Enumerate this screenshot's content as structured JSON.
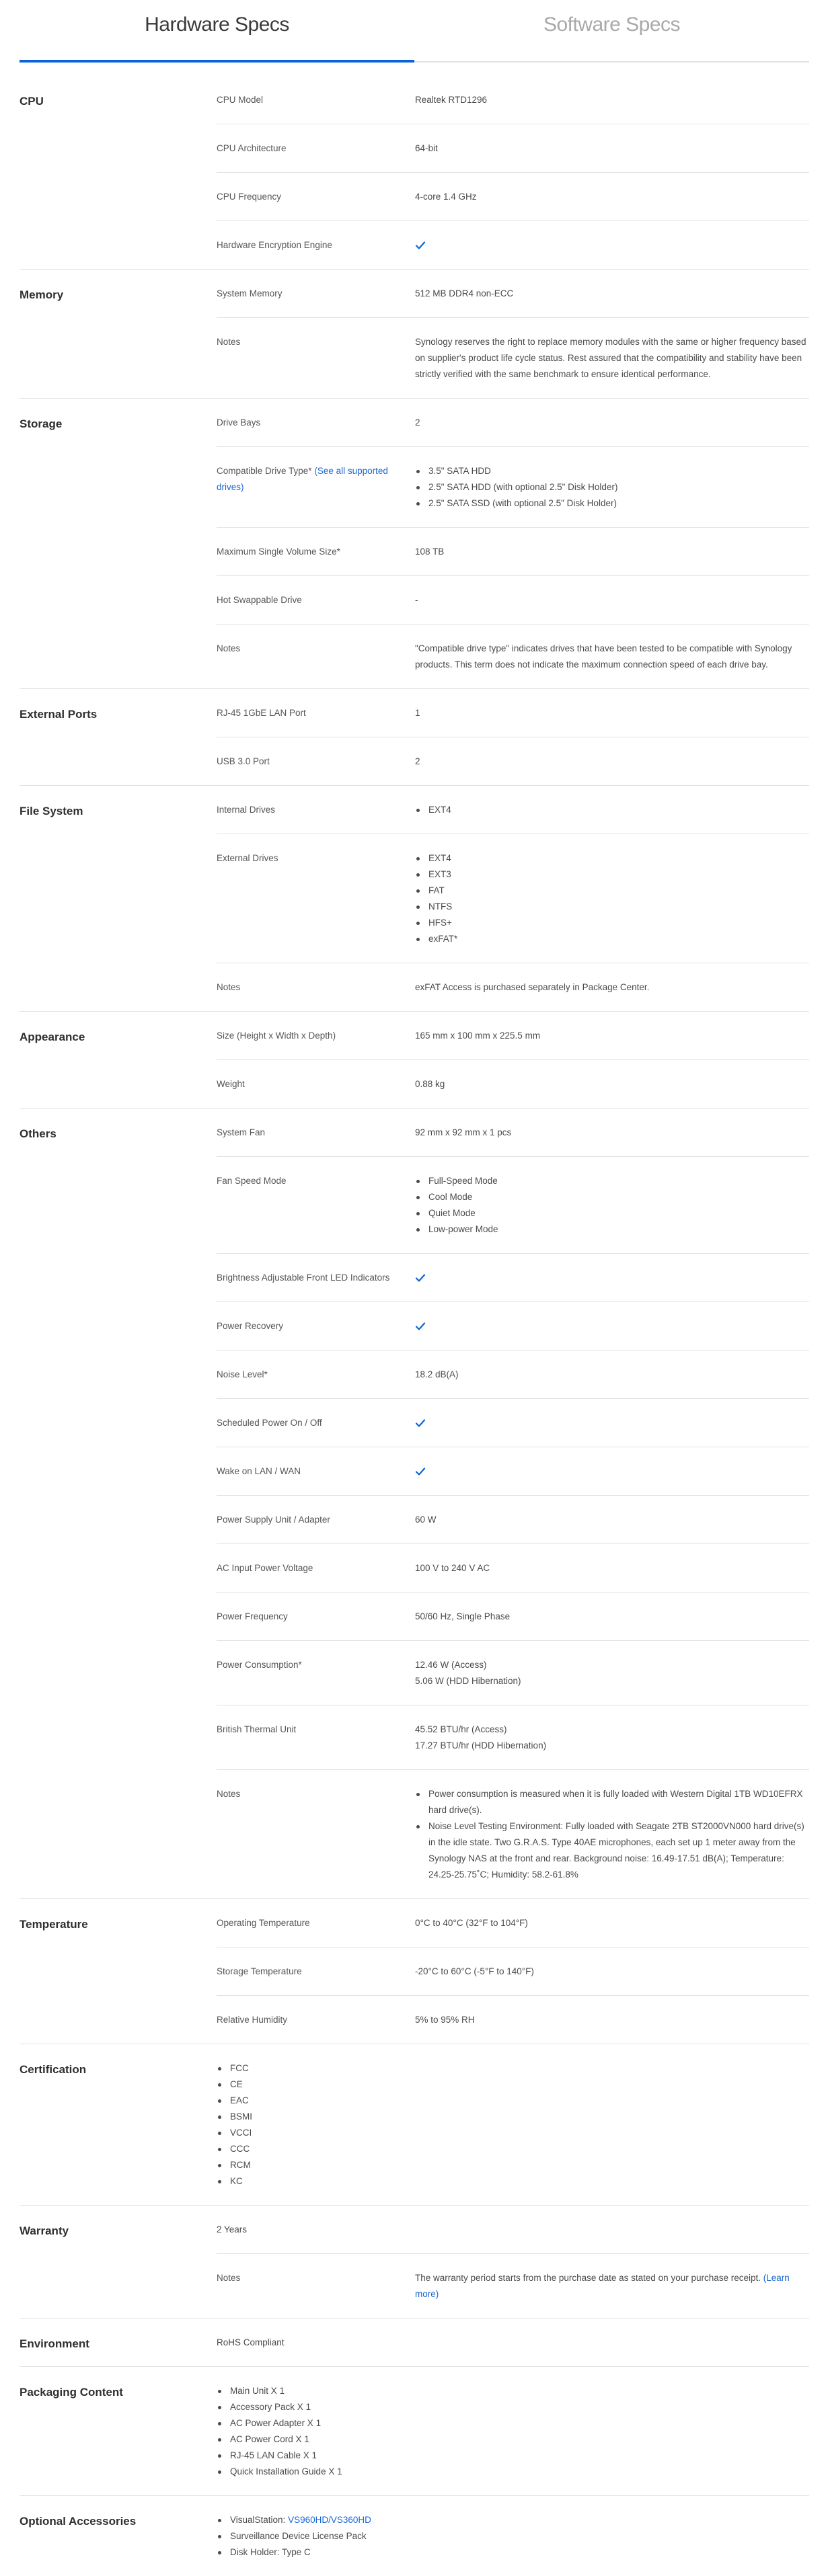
{
  "tabs": [
    {
      "label": "Hardware Specs",
      "active": true
    },
    {
      "label": "Software Specs",
      "active": false
    }
  ],
  "colors": {
    "accent": "#0a64d6",
    "link": "#1a66d2",
    "divider": "#e1e1e1"
  },
  "sections": {
    "cpu": {
      "title": "CPU",
      "rows": [
        {
          "label": "CPU Model",
          "value": "Realtek RTD1296"
        },
        {
          "label": "CPU Architecture",
          "value": "64-bit"
        },
        {
          "label": "CPU Frequency",
          "value": "4-core 1.4 GHz"
        },
        {
          "label": "Hardware Encryption Engine",
          "value_icon": "check-icon"
        }
      ]
    },
    "memory": {
      "title": "Memory",
      "rows": [
        {
          "label": "System Memory",
          "value": "512 MB DDR4 non-ECC"
        },
        {
          "label": "Notes",
          "value": "Synology reserves the right to replace memory modules with the same or higher frequency based on supplier's product life cycle status. Rest assured that the compatibility and stability have been strictly verified with the same benchmark to ensure identical performance."
        }
      ]
    },
    "storage": {
      "title": "Storage",
      "rows": [
        {
          "label": "Drive Bays",
          "value": "2"
        },
        {
          "label": "Compatible Drive Type*",
          "label_link": "(See all supported drives)",
          "items": [
            "3.5\" SATA HDD",
            "2.5\" SATA HDD (with optional 2.5\" Disk Holder)",
            "2.5\" SATA SSD (with optional 2.5\" Disk Holder)"
          ]
        },
        {
          "label": "Maximum Single Volume Size*",
          "value": "108 TB"
        },
        {
          "label": "Hot Swappable Drive",
          "value": "-"
        },
        {
          "label": "Notes",
          "value": "\"Compatible drive type\" indicates drives that have been tested to be compatible with Synology products. This term does not indicate the maximum connection speed of each drive bay."
        }
      ]
    },
    "external_ports": {
      "title": "External Ports",
      "rows": [
        {
          "label": "RJ-45 1GbE LAN Port",
          "value": "1"
        },
        {
          "label": "USB 3.0 Port",
          "value": "2"
        }
      ]
    },
    "file_system": {
      "title": "File System",
      "rows": [
        {
          "label": "Internal Drives",
          "items": [
            "EXT4"
          ]
        },
        {
          "label": "External Drives",
          "items": [
            "EXT4",
            "EXT3",
            "FAT",
            "NTFS",
            "HFS+",
            "exFAT*"
          ]
        },
        {
          "label": "Notes",
          "value": "exFAT Access is purchased separately in Package Center."
        }
      ]
    },
    "appearance": {
      "title": "Appearance",
      "rows": [
        {
          "label": "Size (Height x Width x Depth)",
          "value": "165 mm x 100 mm x 225.5 mm"
        },
        {
          "label": "Weight",
          "value": "0.88 kg"
        }
      ]
    },
    "others": {
      "title": "Others",
      "rows": [
        {
          "label": "System Fan",
          "value": "92 mm x 92 mm x 1 pcs"
        },
        {
          "label": "Fan Speed Mode",
          "items": [
            "Full-Speed Mode",
            "Cool Mode",
            "Quiet Mode",
            "Low-power Mode"
          ]
        },
        {
          "label": "Brightness Adjustable Front LED Indicators",
          "value_icon": "check-icon"
        },
        {
          "label": "Power Recovery",
          "value_icon": "check-icon"
        },
        {
          "label": "Noise Level*",
          "value": "18.2 dB(A)"
        },
        {
          "label": "Scheduled Power On / Off",
          "value_icon": "check-icon"
        },
        {
          "label": "Wake on LAN / WAN",
          "value_icon": "check-icon"
        },
        {
          "label": "Power Supply Unit / Adapter",
          "value": "60 W"
        },
        {
          "label": "AC Input Power Voltage",
          "value": "100 V to 240 V AC"
        },
        {
          "label": "Power Frequency",
          "value": "50/60 Hz, Single Phase"
        },
        {
          "label": "Power Consumption*",
          "lines": [
            "12.46 W (Access)",
            "5.06 W (HDD Hibernation)"
          ]
        },
        {
          "label": "British Thermal Unit",
          "lines": [
            "45.52 BTU/hr (Access)",
            "17.27 BTU/hr (HDD Hibernation)"
          ]
        },
        {
          "label": "Notes",
          "items": [
            "Power consumption is measured when it is fully loaded with Western Digital 1TB WD10EFRX hard drive(s).",
            "Noise Level Testing Environment: Fully loaded with Seagate 2TB ST2000VN000 hard drive(s) in the idle state. Two G.R.A.S. Type 40AE microphones, each set up 1 meter away from the Synology NAS at the front and rear. Background noise: 16.49-17.51 dB(A); Temperature: 24.25-25.75˚C; Humidity: 58.2-61.8%"
          ]
        }
      ]
    },
    "temperature": {
      "title": "Temperature",
      "rows": [
        {
          "label": "Operating Temperature",
          "value": "0°C to 40°C (32°F to 104°F)"
        },
        {
          "label": "Storage Temperature",
          "value": "-20°C to 60°C (-5°F to 140°F)"
        },
        {
          "label": "Relative Humidity",
          "value": "5% to 95% RH"
        }
      ]
    },
    "certification": {
      "title": "Certification",
      "items": [
        "FCC",
        "CE",
        "EAC",
        "BSMI",
        "VCCI",
        "CCC",
        "RCM",
        "KC"
      ]
    },
    "warranty": {
      "title": "Warranty",
      "value": "2 Years",
      "notes_label": "Notes",
      "notes_text": "The warranty period starts from the purchase date as stated on your purchase receipt.",
      "notes_link": "(Learn more)"
    },
    "environment": {
      "title": "Environment",
      "value": "RoHS Compliant"
    },
    "packaging": {
      "title": "Packaging Content",
      "items": [
        "Main Unit X 1",
        "Accessory Pack X 1",
        "AC Power Adapter X 1",
        "AC Power Cord X 1",
        "RJ-45 LAN Cable X 1",
        "Quick Installation Guide X 1"
      ]
    },
    "optional_accessories": {
      "title": "Optional Accessories",
      "visualstation_label": "VisualStation:",
      "visualstation_link": "VS960HD/VS360HD",
      "items": [
        "Surveillance Device License Pack",
        "Disk Holder: Type C"
      ]
    }
  }
}
